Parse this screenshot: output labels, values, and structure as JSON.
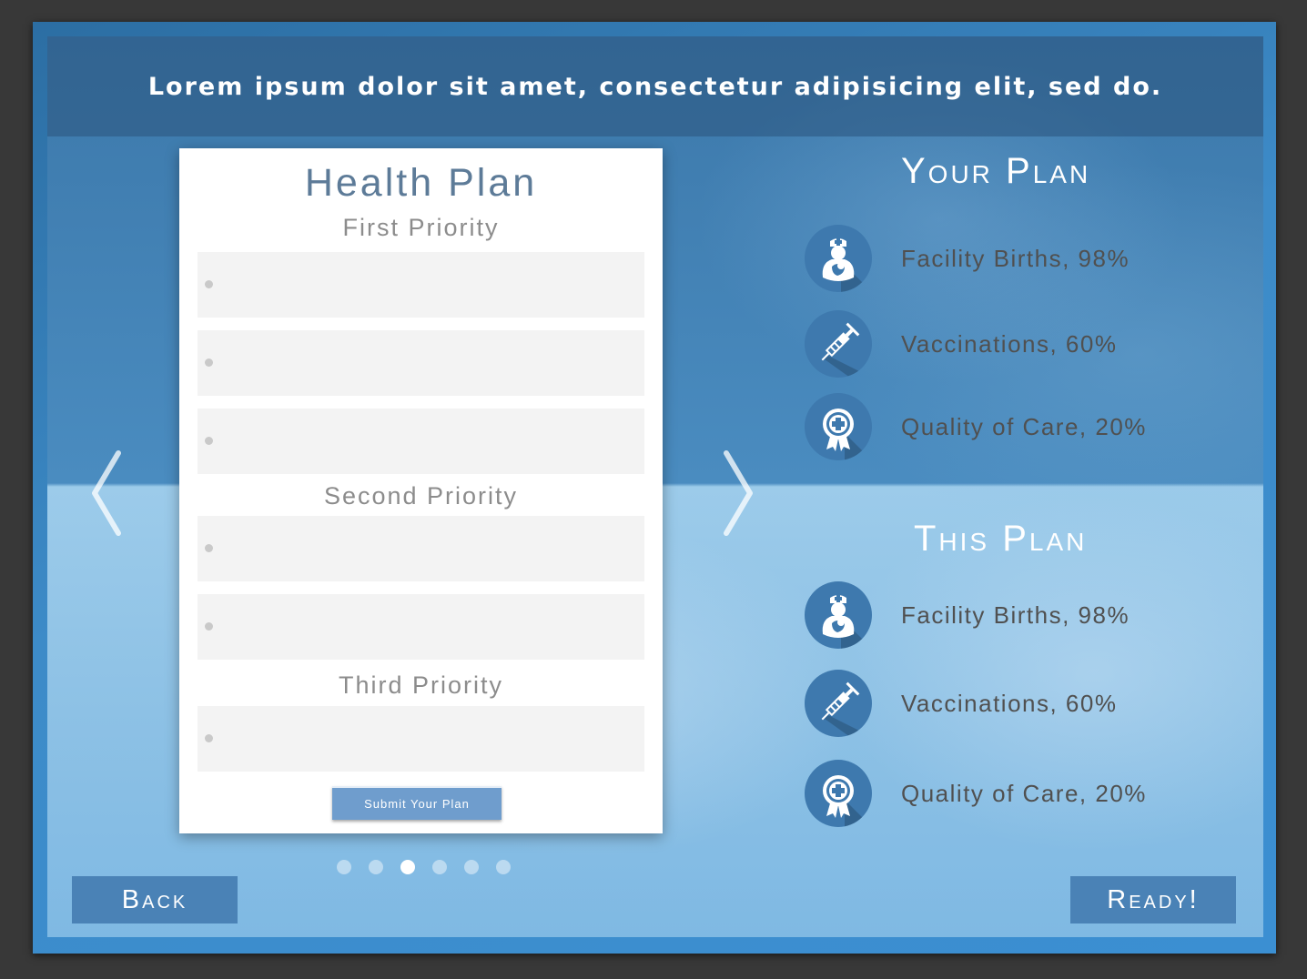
{
  "header": {
    "text": "Lorem ipsum dolor sit amet, consectetur adipisicing elit, sed do."
  },
  "nav": {
    "prev_icon": "chevron-left-icon",
    "next_icon": "chevron-right-icon"
  },
  "card": {
    "title": "Health Plan",
    "priorities": [
      {
        "label": "First Priority",
        "slots": 3
      },
      {
        "label": "Second Priority",
        "slots": 2
      },
      {
        "label": "Third Priority",
        "slots": 1
      }
    ],
    "submit_label": "Submit Your Plan"
  },
  "pager": {
    "count": 6,
    "active_index": 2
  },
  "your_plan": {
    "title": "Your Plan",
    "items": [
      {
        "icon": "nurse-icon",
        "text": "Facility Births, 98%"
      },
      {
        "icon": "syringe-icon",
        "text": "Vaccinations, 60%"
      },
      {
        "icon": "medical-badge-icon",
        "text": "Quality of Care, 20%"
      }
    ]
  },
  "this_plan": {
    "title": "This Plan",
    "items": [
      {
        "icon": "nurse-icon",
        "text": "Facility Births, 98%"
      },
      {
        "icon": "syringe-icon",
        "text": "Vaccinations, 60%"
      },
      {
        "icon": "medical-badge-icon",
        "text": "Quality of Care, 20%"
      }
    ]
  },
  "buttons": {
    "back": "Back",
    "ready": "Ready!"
  },
  "colors": {
    "accent": "#4a82b6",
    "icon_bg": "#3e79ae",
    "header_bg": "#2d5882",
    "card_title": "#5d7b98"
  }
}
